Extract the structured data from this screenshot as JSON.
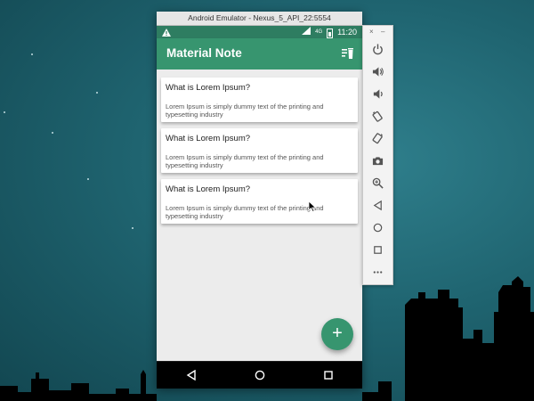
{
  "window": {
    "title": "Android Emulator - Nexus_5_API_22:5554"
  },
  "status_bar": {
    "network": "4G",
    "time": "11:20"
  },
  "app_bar": {
    "title": "Material Note"
  },
  "notes": [
    {
      "title": "What is Lorem Ipsum?",
      "body": "Lorem Ipsum is simply dummy text of the printing and typesetting industry"
    },
    {
      "title": "What is Lorem Ipsum?",
      "body": "Lorem Ipsum is simply dummy text of the printing and typesetting industry"
    },
    {
      "title": "What is Lorem Ipsum?",
      "body": "Lorem Ipsum is simply dummy text of the printing and typesetting industry"
    }
  ],
  "fab": {
    "label": "+"
  },
  "side_toolbar": {
    "close": "×",
    "minimize": "–",
    "tools": [
      "power-icon",
      "volume-up-icon",
      "volume-down-icon",
      "rotate-left-icon",
      "rotate-right-icon",
      "camera-icon",
      "zoom-icon",
      "back-icon",
      "home-icon",
      "overview-icon",
      "more-icon"
    ]
  },
  "colors": {
    "primary": "#37956f",
    "primary_dark": "#2e7d61",
    "background": "#ececec"
  }
}
